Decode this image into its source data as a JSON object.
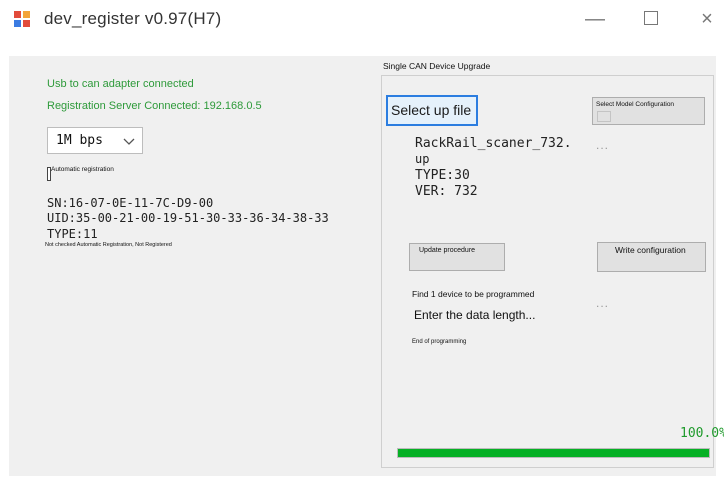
{
  "window": {
    "title": "dev_register v0.97(H7)",
    "controls": {
      "minimize": "—",
      "close": "×"
    }
  },
  "left": {
    "usb_status": "Usb to can adapter connected",
    "server_status": "Registration Server Connected: 192.168.0.5",
    "baud_rate": {
      "selected": "1M bps"
    },
    "auto_registration_label": "Automatic registration",
    "auto_registration_checked": false,
    "device": {
      "sn": "SN:16-07-0E-11-7C-D9-00",
      "uid": "UID:35-00-21-00-19-51-30-33-36-34-38-33",
      "type": "TYPE:11"
    },
    "registration_status": "Not checked Automatic Registration, Not Registered"
  },
  "upgrade": {
    "group_title": "Single CAN Device Upgrade",
    "select_file_label": "Select up file",
    "select_model_label": "Select Model Configuration",
    "file": {
      "name": "RackRail_scaner_732.",
      "ext": "up",
      "type": "TYPE:30",
      "ver": "VER: 732"
    },
    "dots_1": "...",
    "update_label": "Update procedure",
    "write_label": "Write configuration",
    "find_status": "Find 1 device to be programmed",
    "dots_2": "...",
    "data_status": "Enter the data length...",
    "end_status": "End of programming",
    "progress_percent": "100.0%",
    "progress_value": 1.0
  },
  "colors": {
    "status_green": "#2e9a3a",
    "progress_green": "#06b025",
    "focus_blue": "#2b7de0"
  }
}
